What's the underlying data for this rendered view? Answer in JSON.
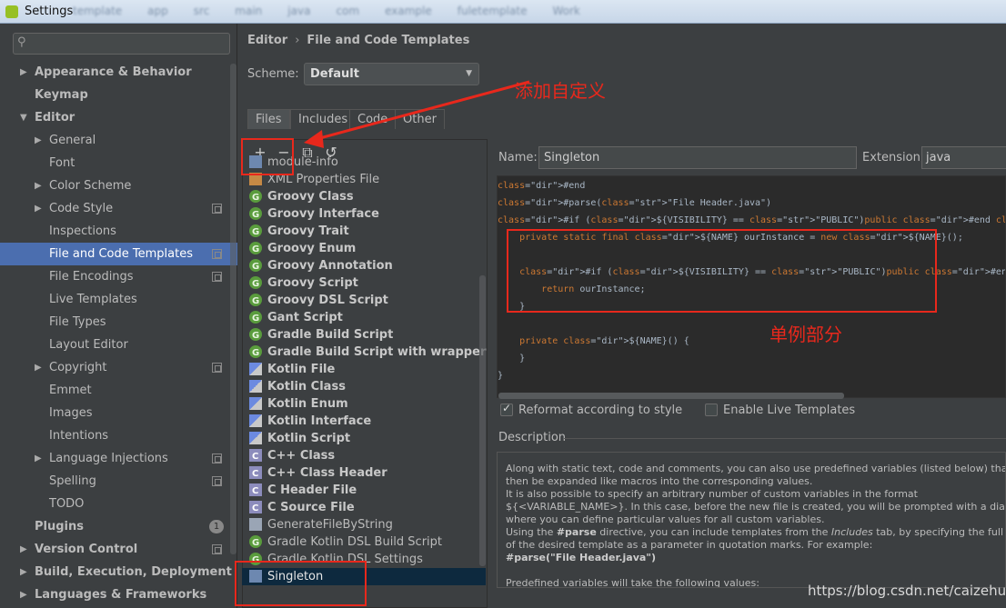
{
  "window": {
    "title": "Settings",
    "blurred_crumbs": [
      "template",
      "app",
      "src",
      "main",
      "java",
      "com",
      "example",
      "fuletemplate",
      "Work"
    ]
  },
  "sidebar": {
    "search_placeholder": "",
    "items": [
      {
        "label": "Appearance & Behavior",
        "arrow": "▶"
      },
      {
        "label": "Keymap"
      },
      {
        "label": "Editor",
        "arrow": "▼"
      },
      {
        "label": "General",
        "arrow": "▶"
      },
      {
        "label": "Font"
      },
      {
        "label": "Color Scheme",
        "arrow": "▶"
      },
      {
        "label": "Code Style",
        "arrow": "▶"
      },
      {
        "label": "Inspections"
      },
      {
        "label": "File and Code Templates"
      },
      {
        "label": "File Encodings"
      },
      {
        "label": "Live Templates"
      },
      {
        "label": "File Types"
      },
      {
        "label": "Layout Editor"
      },
      {
        "label": "Copyright",
        "arrow": "▶"
      },
      {
        "label": "Emmet"
      },
      {
        "label": "Images"
      },
      {
        "label": "Intentions"
      },
      {
        "label": "Language Injections",
        "arrow": "▶"
      },
      {
        "label": "Spelling"
      },
      {
        "label": "TODO"
      },
      {
        "label": "Plugins",
        "badge": "1"
      },
      {
        "label": "Version Control",
        "arrow": "▶"
      },
      {
        "label": "Build, Execution, Deployment",
        "arrow": "▶"
      },
      {
        "label": "Languages & Frameworks",
        "arrow": "▶"
      }
    ]
  },
  "header": {
    "crumb_root": "Editor",
    "crumb_sep": "›",
    "crumb_leaf": "File and Code Templates"
  },
  "scheme": {
    "label": "Scheme:",
    "value": "Default"
  },
  "tabs": [
    "Files",
    "Includes",
    "Code",
    "Other"
  ],
  "toolbar": {
    "add": "+",
    "remove": "−",
    "copy": "⧉",
    "reset": "↺"
  },
  "templates": [
    {
      "label": "module-info",
      "icon": "java"
    },
    {
      "label": "XML Properties File",
      "icon": "xml"
    },
    {
      "label": "Groovy Class",
      "icon": "groovy"
    },
    {
      "label": "Groovy Interface",
      "icon": "groovy"
    },
    {
      "label": "Groovy Trait",
      "icon": "groovy"
    },
    {
      "label": "Groovy Enum",
      "icon": "groovy"
    },
    {
      "label": "Groovy Annotation",
      "icon": "groovy"
    },
    {
      "label": "Groovy Script",
      "icon": "groovy"
    },
    {
      "label": "Groovy DSL Script",
      "icon": "groovy"
    },
    {
      "label": "Gant Script",
      "icon": "groovy"
    },
    {
      "label": "Gradle Build Script",
      "icon": "groovy"
    },
    {
      "label": "Gradle Build Script with wrapper",
      "icon": "groovy"
    },
    {
      "label": "Kotlin File",
      "icon": "kotlin"
    },
    {
      "label": "Kotlin Class",
      "icon": "kotlin"
    },
    {
      "label": "Kotlin Enum",
      "icon": "kotlin"
    },
    {
      "label": "Kotlin Interface",
      "icon": "kotlin"
    },
    {
      "label": "Kotlin Script",
      "icon": "kotlin"
    },
    {
      "label": "C++ Class",
      "icon": "cpp"
    },
    {
      "label": "C++ Class Header",
      "icon": "cpp"
    },
    {
      "label": "C Header File",
      "icon": "cpp"
    },
    {
      "label": "C Source File",
      "icon": "cpp"
    },
    {
      "label": "GenerateFileByString",
      "icon": "file"
    },
    {
      "label": "Gradle Kotlin DSL Build Script",
      "icon": "groovy"
    },
    {
      "label": "Gradle Kotlin DSL Settings",
      "icon": "groovy"
    },
    {
      "label": "Singleton",
      "icon": "java"
    }
  ],
  "detail": {
    "name_label": "Name:",
    "name_value": "Singleton",
    "ext_label": "Extension:",
    "ext_value": "java",
    "code_lines": [
      "#end",
      "#parse(\"File Header.java\")",
      "#if (${VISIBILITY} == \"PUBLIC\")public #end class ${NAME} #if (${SUPERCLASS} != \"\")extends ${SUPERCLASS} #end {",
      "    private static final ${NAME} ourInstance = new ${NAME}();",
      "",
      "    #if (${VISIBILITY} == \"PUBLIC\")public #end static ${NAME} getInstance() {",
      "        return ourInstance;",
      "    }",
      "",
      "    private ${NAME}() {",
      "    }",
      "}"
    ],
    "reformat_label": "Reformat according to style",
    "live_label": "Enable Live Templates",
    "description_label": "Description",
    "description_lines": [
      "Along with static text, code and comments, you can also use predefined variables (listed below) that will",
      "then be expanded like macros into the corresponding values.",
      "It is also possible to specify an arbitrary number of custom variables in the format",
      "${<VARIABLE_NAME>}. In this case, before the new file is created, you will be prompted with a dialog",
      "where you can define particular values for all custom variables.",
      "Using the #parse directive, you can include templates from the Includes tab, by specifying the full name",
      "of the desired template as a parameter in quotation marks. For example:",
      "#parse(\"File Header.java\")",
      "",
      "Predefined variables will take the following values:"
    ]
  },
  "annotations": {
    "add_custom": "添加自定义",
    "singleton_part": "单例部分",
    "color": "#e8281c"
  },
  "watermark": "https://blog.csdn.net/caizehui"
}
